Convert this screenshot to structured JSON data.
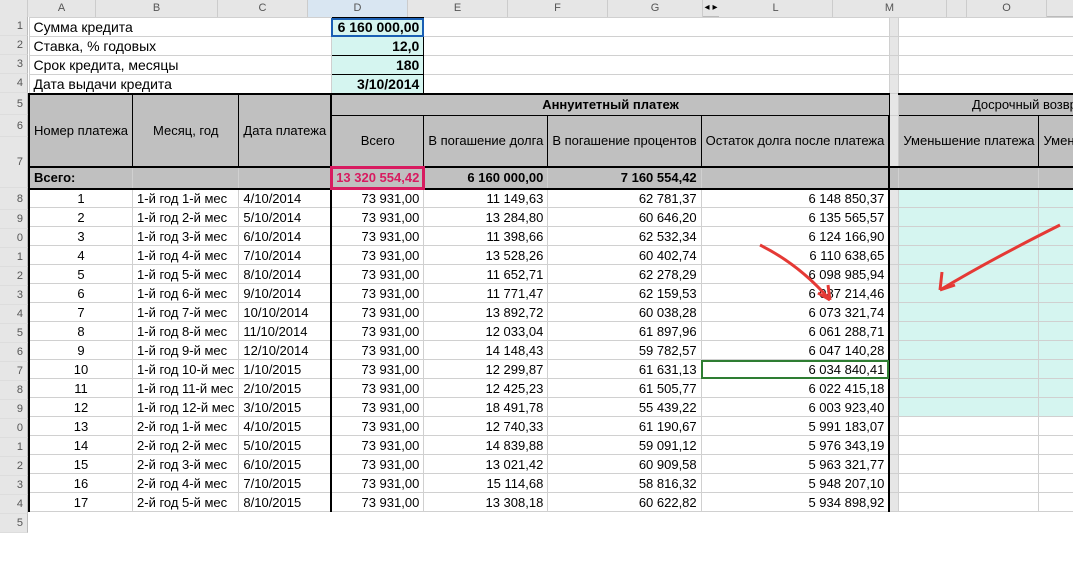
{
  "columns": [
    "A",
    "B",
    "C",
    "D",
    "E",
    "F",
    "G",
    "L",
    "M",
    "O"
  ],
  "col_widths": {
    "A": 68,
    "B": 122,
    "C": 90,
    "D": 100,
    "E": 100,
    "F": 100,
    "G": 100,
    "gap": 12,
    "L": 114,
    "M": 114,
    "blank": 20,
    "O": 80
  },
  "row_labels": [
    "1",
    "2",
    "3",
    "4",
    "5",
    "6",
    "7",
    "8",
    "9",
    "0",
    "1",
    "2",
    "3",
    "4",
    "5",
    "6",
    "7",
    "8",
    "9",
    "0",
    "1",
    "2",
    "3",
    "4",
    "5"
  ],
  "params": {
    "sum_label": "Сумма кредита",
    "sum": "6 160 000,00",
    "rate_label": "Ставка, % годовых",
    "rate": "12,0",
    "term_label": "Срок кредита, месяцы",
    "term": "180",
    "date_label": "Дата выдачи кредита",
    "date": "3/10/2014"
  },
  "headers": {
    "num": "Номер платежа",
    "month": "Месяц, год",
    "pdate": "Дата платежа",
    "annuity": "Аннуитетный платеж",
    "total": "Всего",
    "principal": "В погашение долга",
    "interest": "В погашение процентов",
    "balance": "Остаток долга после платежа",
    "early": "Досрочный возврат",
    "reduce_pay": "Уменьшение платежа",
    "reduce_term": "Уменьшение срока"
  },
  "totals": {
    "label": "Всего:",
    "total": "13 320 554,42",
    "principal": "6 160 000,00",
    "interest": "7 160 554,42"
  },
  "rows": [
    {
      "n": "1",
      "m": "1-й год 1-й мес",
      "d": "4/10/2014",
      "t": "73 931,00",
      "p": "11 149,63",
      "i": "62 781,37",
      "b": "6 148 850,37"
    },
    {
      "n": "2",
      "m": "1-й год 2-й мес",
      "d": "5/10/2014",
      "t": "73 931,00",
      "p": "13 284,80",
      "i": "60 646,20",
      "b": "6 135 565,57"
    },
    {
      "n": "3",
      "m": "1-й год 3-й мес",
      "d": "6/10/2014",
      "t": "73 931,00",
      "p": "11 398,66",
      "i": "62 532,34",
      "b": "6 124 166,90"
    },
    {
      "n": "4",
      "m": "1-й год 4-й мес",
      "d": "7/10/2014",
      "t": "73 931,00",
      "p": "13 528,26",
      "i": "60 402,74",
      "b": "6 110 638,65"
    },
    {
      "n": "5",
      "m": "1-й год 5-й мес",
      "d": "8/10/2014",
      "t": "73 931,00",
      "p": "11 652,71",
      "i": "62 278,29",
      "b": "6 098 985,94"
    },
    {
      "n": "6",
      "m": "1-й год 6-й мес",
      "d": "9/10/2014",
      "t": "73 931,00",
      "p": "11 771,47",
      "i": "62 159,53",
      "b": "6 087 214,46"
    },
    {
      "n": "7",
      "m": "1-й год 7-й мес",
      "d": "10/10/2014",
      "t": "73 931,00",
      "p": "13 892,72",
      "i": "60 038,28",
      "b": "6 073 321,74"
    },
    {
      "n": "8",
      "m": "1-й год 8-й мес",
      "d": "11/10/2014",
      "t": "73 931,00",
      "p": "12 033,04",
      "i": "61 897,96",
      "b": "6 061 288,71"
    },
    {
      "n": "9",
      "m": "1-й год 9-й мес",
      "d": "12/10/2014",
      "t": "73 931,00",
      "p": "14 148,43",
      "i": "59 782,57",
      "b": "6 047 140,28"
    },
    {
      "n": "10",
      "m": "1-й год 10-й мес",
      "d": "1/10/2015",
      "t": "73 931,00",
      "p": "12 299,87",
      "i": "61 631,13",
      "b": "6 034 840,41",
      "gsel": true
    },
    {
      "n": "11",
      "m": "1-й год 11-й мес",
      "d": "2/10/2015",
      "t": "73 931,00",
      "p": "12 425,23",
      "i": "61 505,77",
      "b": "6 022 415,18"
    },
    {
      "n": "12",
      "m": "1-й год 12-й мес",
      "d": "3/10/2015",
      "t": "73 931,00",
      "p": "18 491,78",
      "i": "55 439,22",
      "b": "6 003 923,40"
    },
    {
      "n": "13",
      "m": "2-й год 1-й мес",
      "d": "4/10/2015",
      "t": "73 931,00",
      "p": "12 740,33",
      "i": "61 190,67",
      "b": "5 991 183,07",
      "y2": true
    },
    {
      "n": "14",
      "m": "2-й год 2-й мес",
      "d": "5/10/2015",
      "t": "73 931,00",
      "p": "14 839,88",
      "i": "59 091,12",
      "b": "5 976 343,19",
      "y2": true
    },
    {
      "n": "15",
      "m": "2-й год 3-й мес",
      "d": "6/10/2015",
      "t": "73 931,00",
      "p": "13 021,42",
      "i": "60 909,58",
      "b": "5 963 321,77",
      "y2": true
    },
    {
      "n": "16",
      "m": "2-й год 4-й мес",
      "d": "7/10/2015",
      "t": "73 931,00",
      "p": "15 114,68",
      "i": "58 816,32",
      "b": "5 948 207,10",
      "y2": true
    },
    {
      "n": "17",
      "m": "2-й год 5-й мес",
      "d": "8/10/2015",
      "t": "73 931,00",
      "p": "13 308,18",
      "i": "60 622,82",
      "b": "5 934 898,92",
      "y2": true
    }
  ]
}
